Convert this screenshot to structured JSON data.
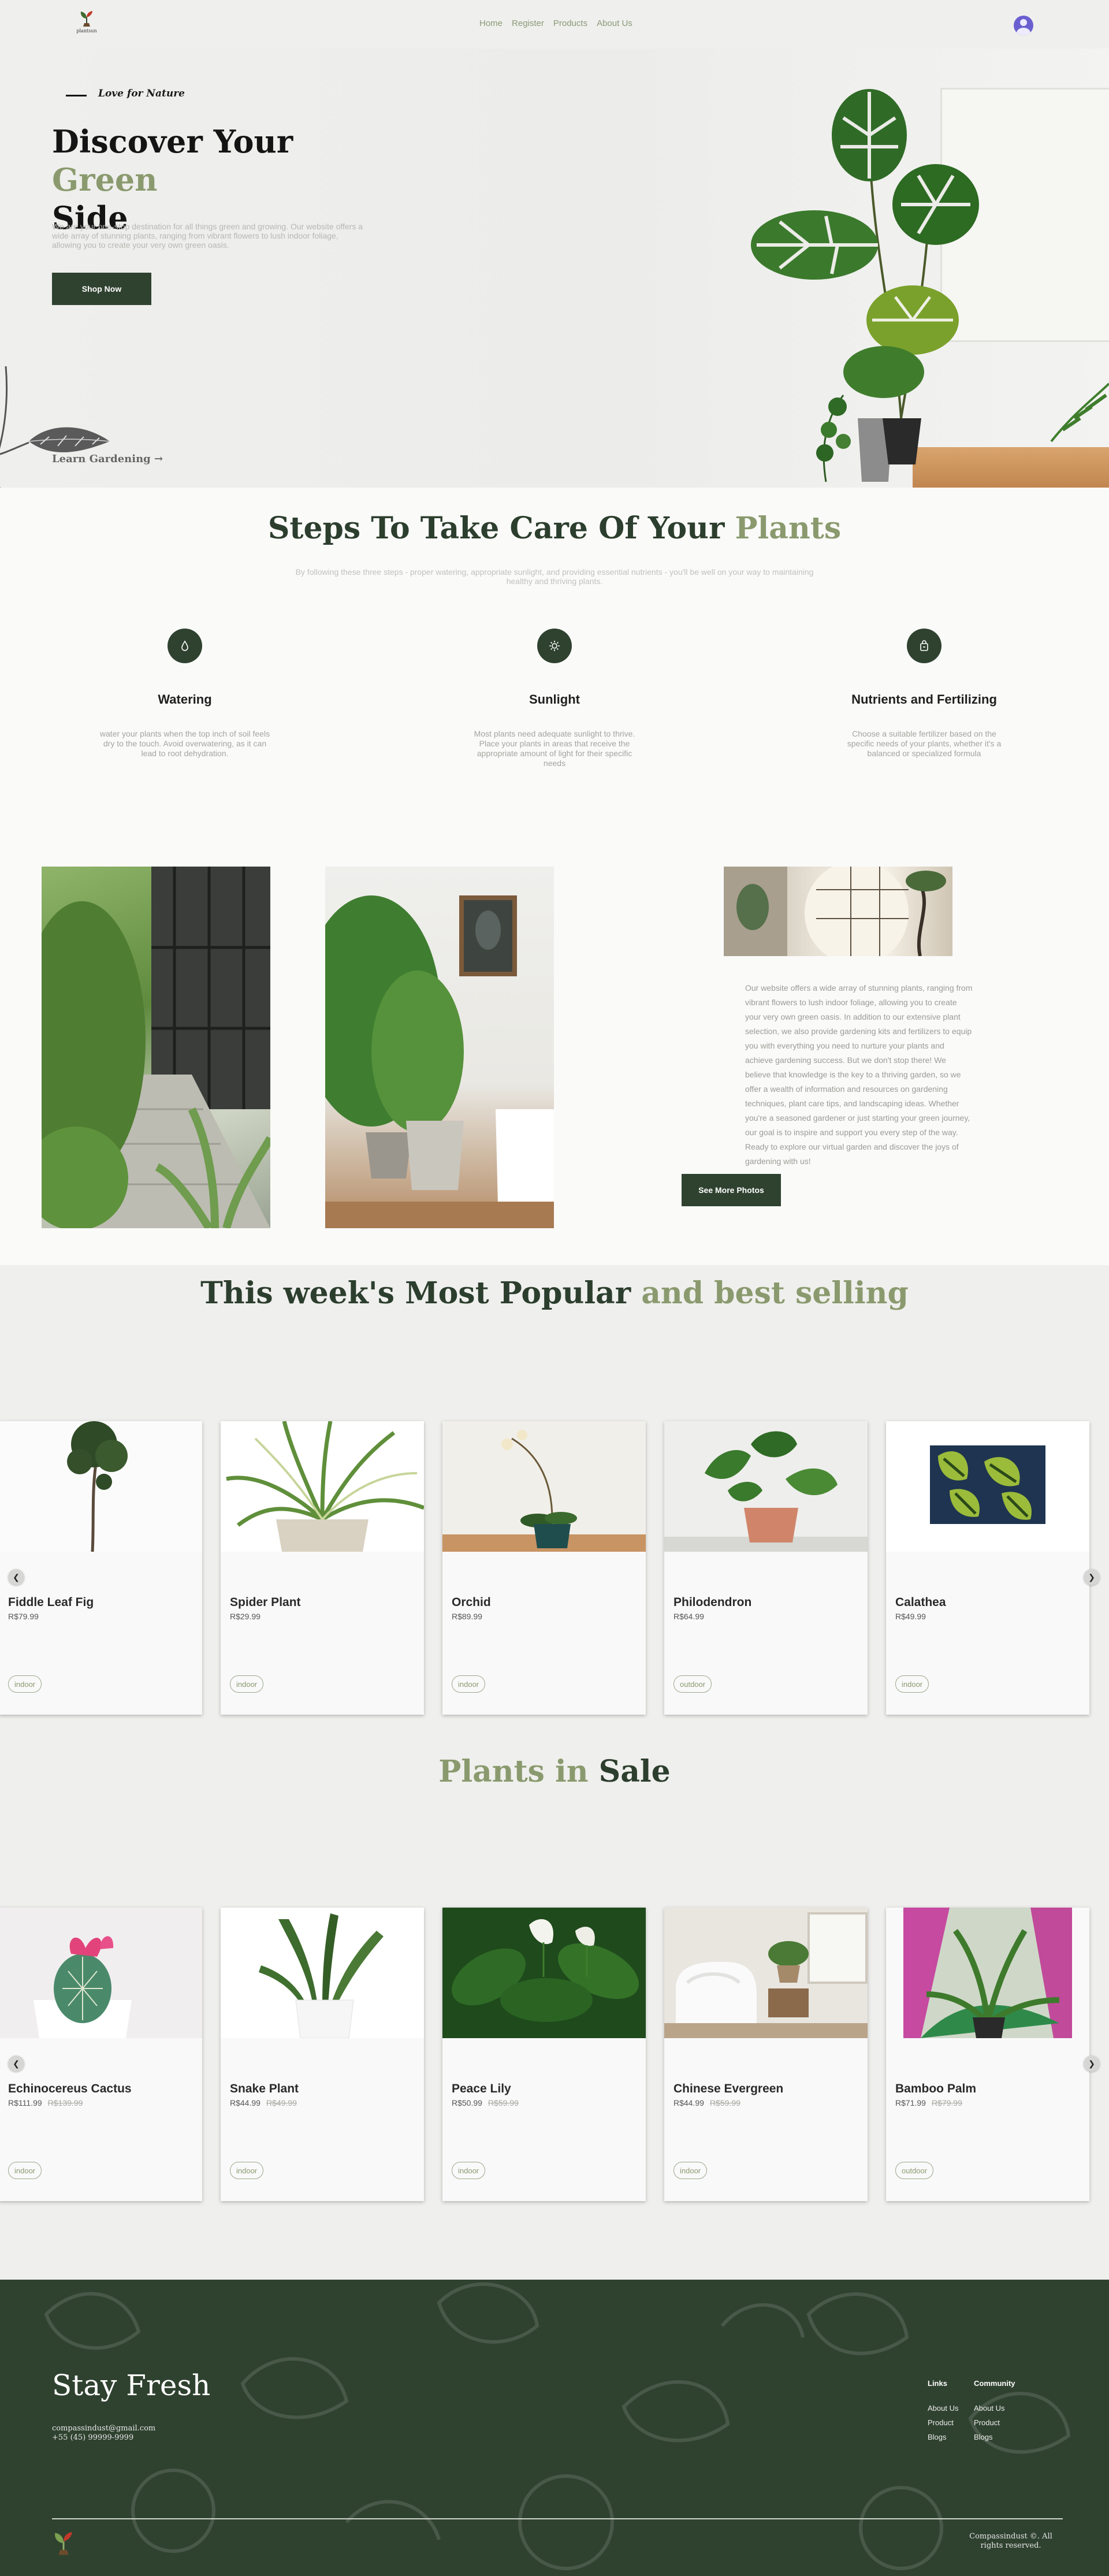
{
  "nav": {
    "logo_text": "plantsun",
    "links": [
      "Home",
      "Register",
      "Products",
      "About Us"
    ]
  },
  "hero": {
    "tagline": "Love for Nature",
    "title_part1": "Discover Your ",
    "title_green": "Green",
    "title_part2": "Side",
    "description": "We are your one-stop destination for all things green and growing. Our website offers a wide array of stunning plants, ranging from vibrant flowers to lush indoor foliage, allowing you to create your very own green oasis.",
    "button": "Shop Now",
    "learn_link": "Learn Gardening →"
  },
  "steps": {
    "title_part1": "Steps To Take Care Of Your ",
    "title_green": "Plants",
    "subtitle": "By following these three steps - proper watering, appropriate sunlight, and providing essential nutrients - you'll be well on your way to maintaining healthy and thriving plants.",
    "items": [
      {
        "icon": "droplet-icon",
        "title": "Watering",
        "text": "water your plants when the top inch of soil feels dry to the touch. Avoid overwatering, as it can lead to root dehydration."
      },
      {
        "icon": "sun-icon",
        "title": "Sunlight",
        "text": "Most plants need adequate sunlight to thrive. Place your plants in areas that receive the appropriate amount of light for their specific needs"
      },
      {
        "icon": "bag-icon",
        "title": "Nutrients and Fertilizing",
        "text": "Choose a suitable fertilizer based on the specific needs of your plants, whether it's a balanced or specialized formula"
      }
    ]
  },
  "about": {
    "text": "Our website offers a wide array of stunning plants, ranging from vibrant flowers to lush indoor foliage, allowing you to create your very own green oasis. In addition to our extensive plant selection, we also provide gardening kits and fertilizers to equip you with everything you need to nurture your plants and achieve gardening success. But we don't stop there! We believe that knowledge is the key to a thriving garden, so we offer a wealth of information and resources on gardening techniques, plant care tips, and landscaping ideas. Whether you're a seasoned gardener or just starting your green journey, our goal is to inspire and support you every step of the way. Ready to explore our virtual garden and discover the joys of gardening with us!",
    "button": "See More Photos"
  },
  "popular": {
    "title_part1": "This week's Most Popular ",
    "title_green": "and best selling",
    "products": [
      {
        "name": "Fiddle Leaf Fig",
        "price": "R$79.99",
        "tag": "indoor"
      },
      {
        "name": "Spider Plant",
        "price": "R$29.99",
        "tag": "indoor"
      },
      {
        "name": "Orchid",
        "price": "R$89.99",
        "tag": "indoor"
      },
      {
        "name": "Philodendron",
        "price": "R$64.99",
        "tag": "outdoor"
      },
      {
        "name": "Calathea",
        "price": "R$49.99",
        "tag": "indoor"
      }
    ]
  },
  "sale": {
    "title_green": "Plants in ",
    "title_part2": "Sale",
    "products": [
      {
        "name": "Echinocereus Cactus",
        "price": "R$111.99",
        "old_price": "R$139.99",
        "tag": "indoor"
      },
      {
        "name": "Snake Plant",
        "price": "R$44.99",
        "old_price": "R$49.99",
        "tag": "indoor"
      },
      {
        "name": "Peace Lily",
        "price": "R$50.99",
        "old_price": "R$59.99",
        "tag": "indoor"
      },
      {
        "name": "Chinese Evergreen",
        "price": "R$44.99",
        "old_price": "R$59.99",
        "tag": "indoor"
      },
      {
        "name": "Bamboo Palm",
        "price": "R$71.99",
        "old_price": "R$79.99",
        "tag": "outdoor"
      }
    ]
  },
  "footer": {
    "title": "Stay Fresh",
    "email": "compassindust@gmail.com",
    "phone": "+55 (45) 99999-9999",
    "links_heading": "Links",
    "links": [
      "About Us",
      "Product",
      "Blogs"
    ],
    "community_heading": "Community",
    "community": [
      "About Us",
      "Product",
      "Blogs"
    ],
    "copyright": "Compassindust ©. All rights reserved."
  }
}
